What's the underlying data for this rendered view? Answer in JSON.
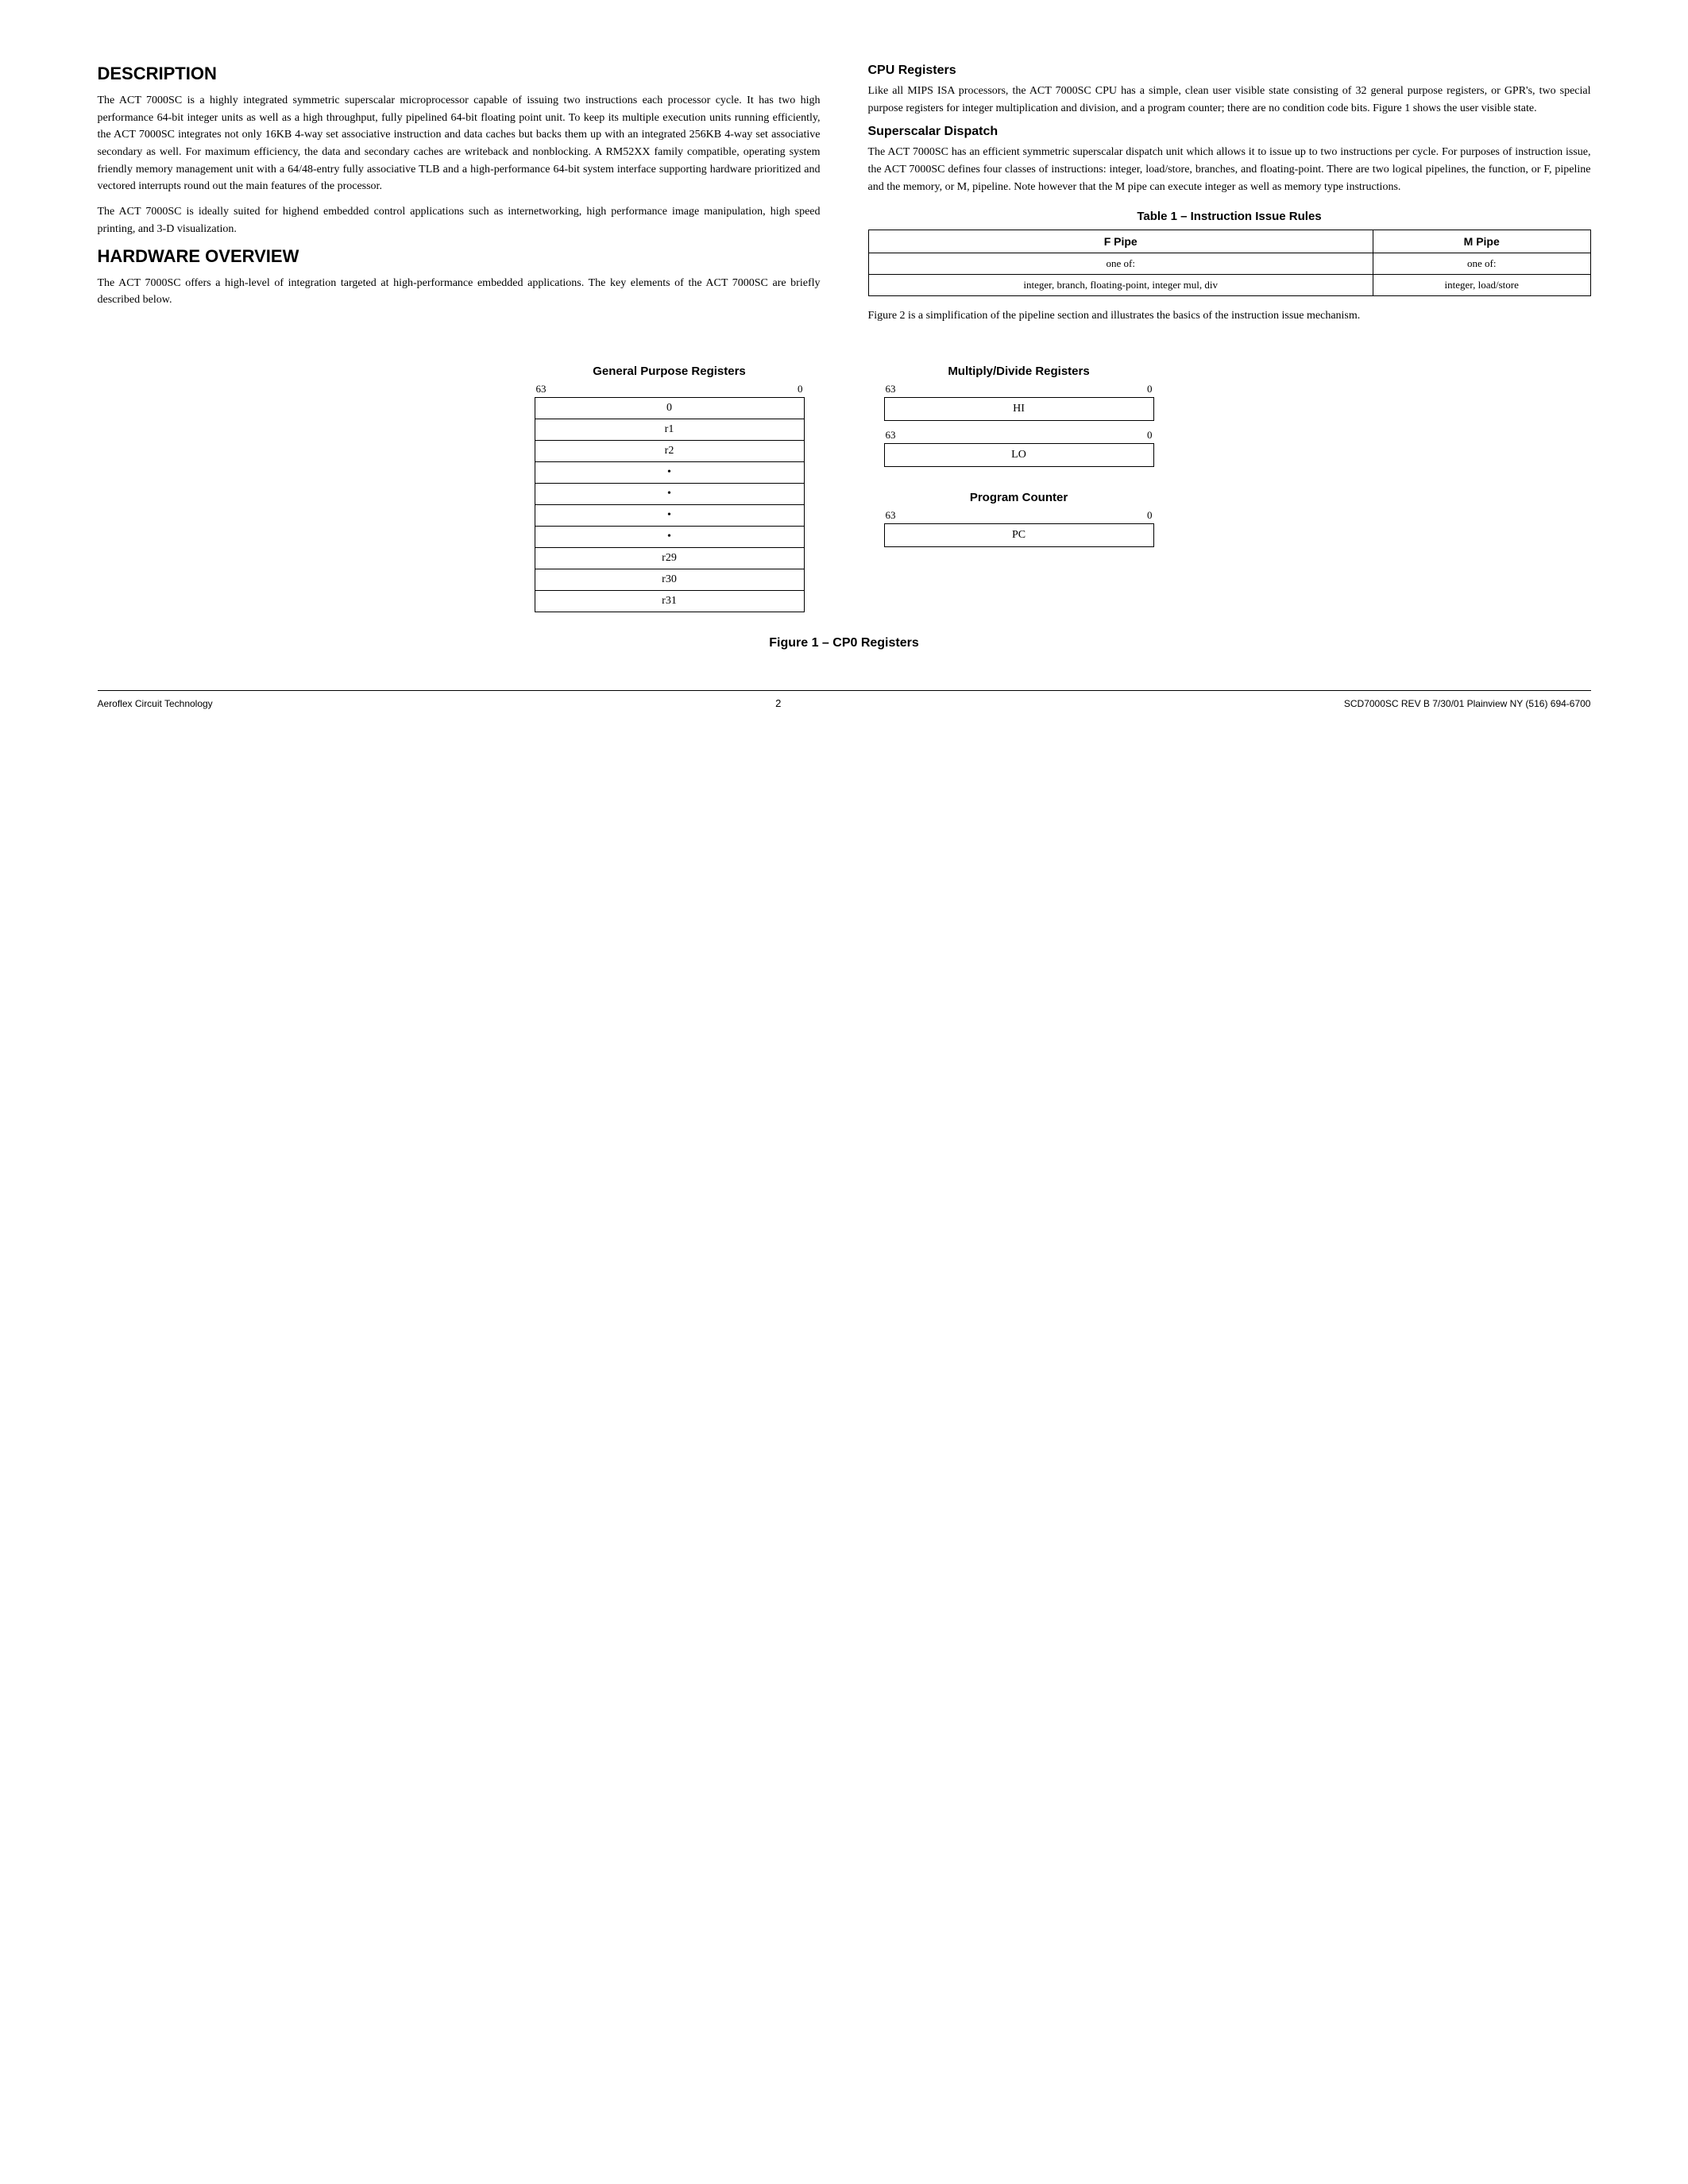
{
  "page": {
    "description_title": "DESCRIPTION",
    "hardware_title": "HARDWARE OVERVIEW",
    "description_p1": "The ACT 7000SC is a highly integrated symmetric superscalar microprocessor capable of issuing two instructions each processor cycle. It has two high performance 64-bit integer units as well as a high throughput, fully pipelined 64-bit floating point unit. To keep its multiple execution units running efficiently, the ACT 7000SC integrates not only 16KB 4-way set associative instruction and data caches but backs them up with an integrated 256KB 4-way set associative secondary as well. For maximum efficiency, the data and secondary caches are writeback and nonblocking. A RM52XX family compatible, operating system friendly memory management unit with a 64/48-entry fully associative TLB and a high-performance 64-bit system interface supporting hardware prioritized and vectored interrupts round out the main features of the processor.",
    "description_p2": "The ACT 7000SC is ideally suited for highend embedded control applications such as internetworking, high performance image manipulation, high speed printing, and 3-D visualization.",
    "hardware_p1": "The ACT 7000SC offers a high-level of integration targeted at high-performance embedded applications. The key elements of the ACT 7000SC are briefly described below.",
    "cpu_registers_title": "CPU Registers",
    "cpu_registers_p1": "Like all MIPS ISA processors, the ACT 7000SC CPU has a simple, clean user visible state consisting of 32 general purpose registers, or GPR's, two special purpose registers for integer multiplication and division, and a program counter; there are no condition code bits. Figure 1 shows the user visible state.",
    "superscalar_title": "Superscalar Dispatch",
    "superscalar_p1": "The ACT 7000SC has an efficient symmetric superscalar dispatch unit which allows it to issue up to two instructions per cycle. For purposes of instruction issue, the ACT 7000SC defines four classes of instructions: integer, load/store, branches, and floating-point. There are two logical pipelines, the function, or F, pipeline and the memory, or M, pipeline. Note however that the M pipe can execute integer as well as memory type instructions.",
    "table_title": "Table 1 – Instruction Issue Rules",
    "table": {
      "headers": [
        "F Pipe",
        "M Pipe"
      ],
      "row1": [
        "one of:",
        "one of:"
      ],
      "row2": [
        "integer, branch, floating-point, integer mul, div",
        "integer, load/store"
      ]
    },
    "figure2_text": "Figure 2 is a simplification of the pipeline section and illustrates the basics of the instruction issue mechanism.",
    "figure_caption": "Figure 1 – CP0 Registers",
    "gpr_title": "General Purpose Registers",
    "gpr_bit_high": "63",
    "gpr_bit_low": "0",
    "gpr_rows": [
      "0",
      "r1",
      "r2",
      "•",
      "•",
      "•",
      "•",
      "r29",
      "r30",
      "r31"
    ],
    "md_title": "Multiply/Divide Registers",
    "md_bit_high": "63",
    "md_bit_low": "0",
    "md_hi_label": "HI",
    "md_hi_bit_high": "63",
    "md_hi_bit_low": "0",
    "md_lo_label": "LO",
    "md_lo_bit_high": "63",
    "md_lo_bit_low": "0",
    "pc_title": "Program Counter",
    "pc_bit_high": "63",
    "pc_bit_low": "0",
    "pc_label": "PC",
    "footer_left": "Aeroflex Circuit Technology",
    "footer_center": "2",
    "footer_right": "SCD7000SC REV B  7/30/01  Plainview NY (516) 694-6700"
  }
}
